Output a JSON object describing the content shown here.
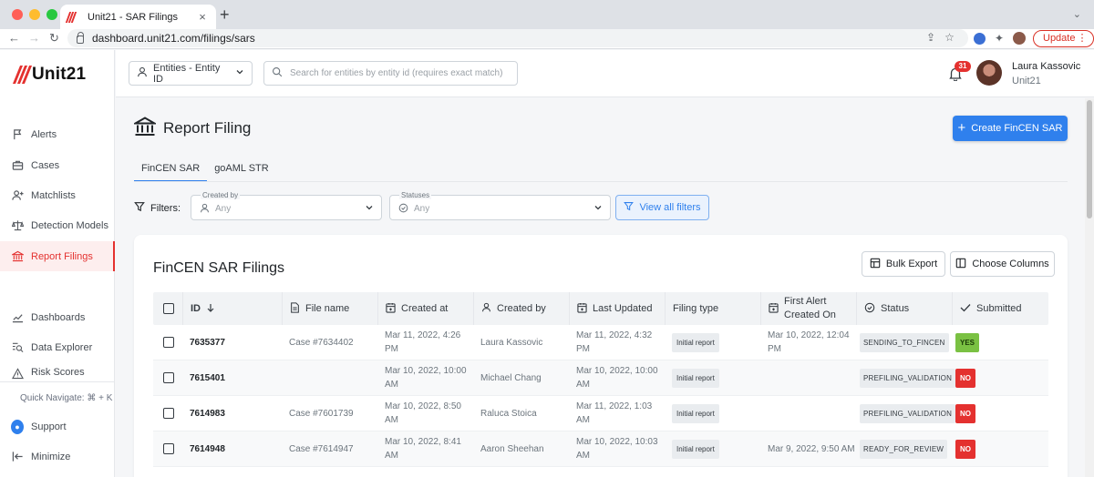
{
  "browser": {
    "tab_title": "Unit21 - SAR Filings",
    "tab_close": "×",
    "new_tab": "+",
    "url": "dashboard.unit21.com/filings/sars",
    "update_label": "Update",
    "update_menu": "⋮"
  },
  "sidebar": {
    "logo_text": "Unit21",
    "items": [
      {
        "label": "Alerts",
        "icon": "flag-icon"
      },
      {
        "label": "Cases",
        "icon": "briefcase-icon"
      },
      {
        "label": "Matchlists",
        "icon": "user-plus-icon"
      },
      {
        "label": "Detection Models",
        "icon": "scale-icon"
      },
      {
        "label": "Report Filings",
        "icon": "bank-icon",
        "active": true
      },
      {
        "label": "Dashboards",
        "icon": "chart-line-icon"
      },
      {
        "label": "Data Explorer",
        "icon": "search-list-icon"
      },
      {
        "label": "Risk Scores",
        "icon": "warning-icon"
      }
    ],
    "quick_navigate": "Quick Navigate: ⌘ + K",
    "support": "Support",
    "minimize": "Minimize"
  },
  "topbar": {
    "entity_select": "Entities - Entity ID",
    "search_placeholder": "Search for entities by entity id (requires exact match)",
    "notifications_count": "31",
    "user_name": "Laura Kassovic",
    "user_org": "Unit21"
  },
  "page": {
    "title": "Report Filing",
    "create_button": "Create FinCEN SAR",
    "tabs": [
      "FinCEN SAR",
      "goAML STR"
    ],
    "filters_label": "Filters:",
    "filter_created_by": {
      "label": "Created by",
      "value": "Any"
    },
    "filter_statuses": {
      "label": "Statuses",
      "value": "Any"
    },
    "view_all_filters": "View all filters"
  },
  "card": {
    "title": "FinCEN SAR Filings",
    "bulk_export": "Bulk Export",
    "choose_columns": "Choose Columns",
    "columns": {
      "id": "ID",
      "file_name": "File name",
      "created_at": "Created at",
      "created_by": "Created by",
      "last_updated": "Last Updated",
      "filing_type": "Filing type",
      "first_alert_1": "First Alert",
      "first_alert_2": "Created On",
      "status": "Status",
      "submitted": "Submitted"
    },
    "rows": [
      {
        "id": "7635377",
        "file_name": "Case #7634402",
        "created_at_1": "Mar 11, 2022, 4:26",
        "created_at_2": "PM",
        "created_by": "Laura Kassovic",
        "last_updated_1": "Mar 11, 2022, 4:32",
        "last_updated_2": "PM",
        "filing_type": "Initial report",
        "first_alert_1": "Mar 10, 2022, 12:04",
        "first_alert_2": "PM",
        "status": "SENDING_TO_FINCEN",
        "submitted": "YES"
      },
      {
        "id": "7615401",
        "file_name": "",
        "created_at_1": "Mar 10, 2022, 10:00",
        "created_at_2": "AM",
        "created_by": "Michael Chang",
        "last_updated_1": "Mar 10, 2022, 10:00",
        "last_updated_2": "AM",
        "filing_type": "Initial report",
        "first_alert_1": "",
        "first_alert_2": "",
        "status": "PREFILING_VALIDATION",
        "submitted": "NO"
      },
      {
        "id": "7614983",
        "file_name": "Case #7601739",
        "created_at_1": "Mar 10, 2022, 8:50",
        "created_at_2": "AM",
        "created_by": "Raluca Stoica",
        "last_updated_1": "Mar 11, 2022, 1:03",
        "last_updated_2": "AM",
        "filing_type": "Initial report",
        "first_alert_1": "",
        "first_alert_2": "",
        "status": "PREFILING_VALIDATION",
        "submitted": "NO"
      },
      {
        "id": "7614948",
        "file_name": "Case #7614947",
        "created_at_1": "Mar 10, 2022, 8:41",
        "created_at_2": "AM",
        "created_by": "Aaron Sheehan",
        "last_updated_1": "Mar 10, 2022, 10:03",
        "last_updated_2": "AM",
        "filing_type": "Initial report",
        "first_alert_1": "Mar 9, 2022, 9:50 AM",
        "first_alert_2": "",
        "status": "READY_FOR_REVIEW",
        "submitted": "NO"
      }
    ]
  },
  "colors": {
    "brand": "#e4312f",
    "accent": "#2f80ed",
    "yes": "#7ac143",
    "no": "#e4312f"
  }
}
